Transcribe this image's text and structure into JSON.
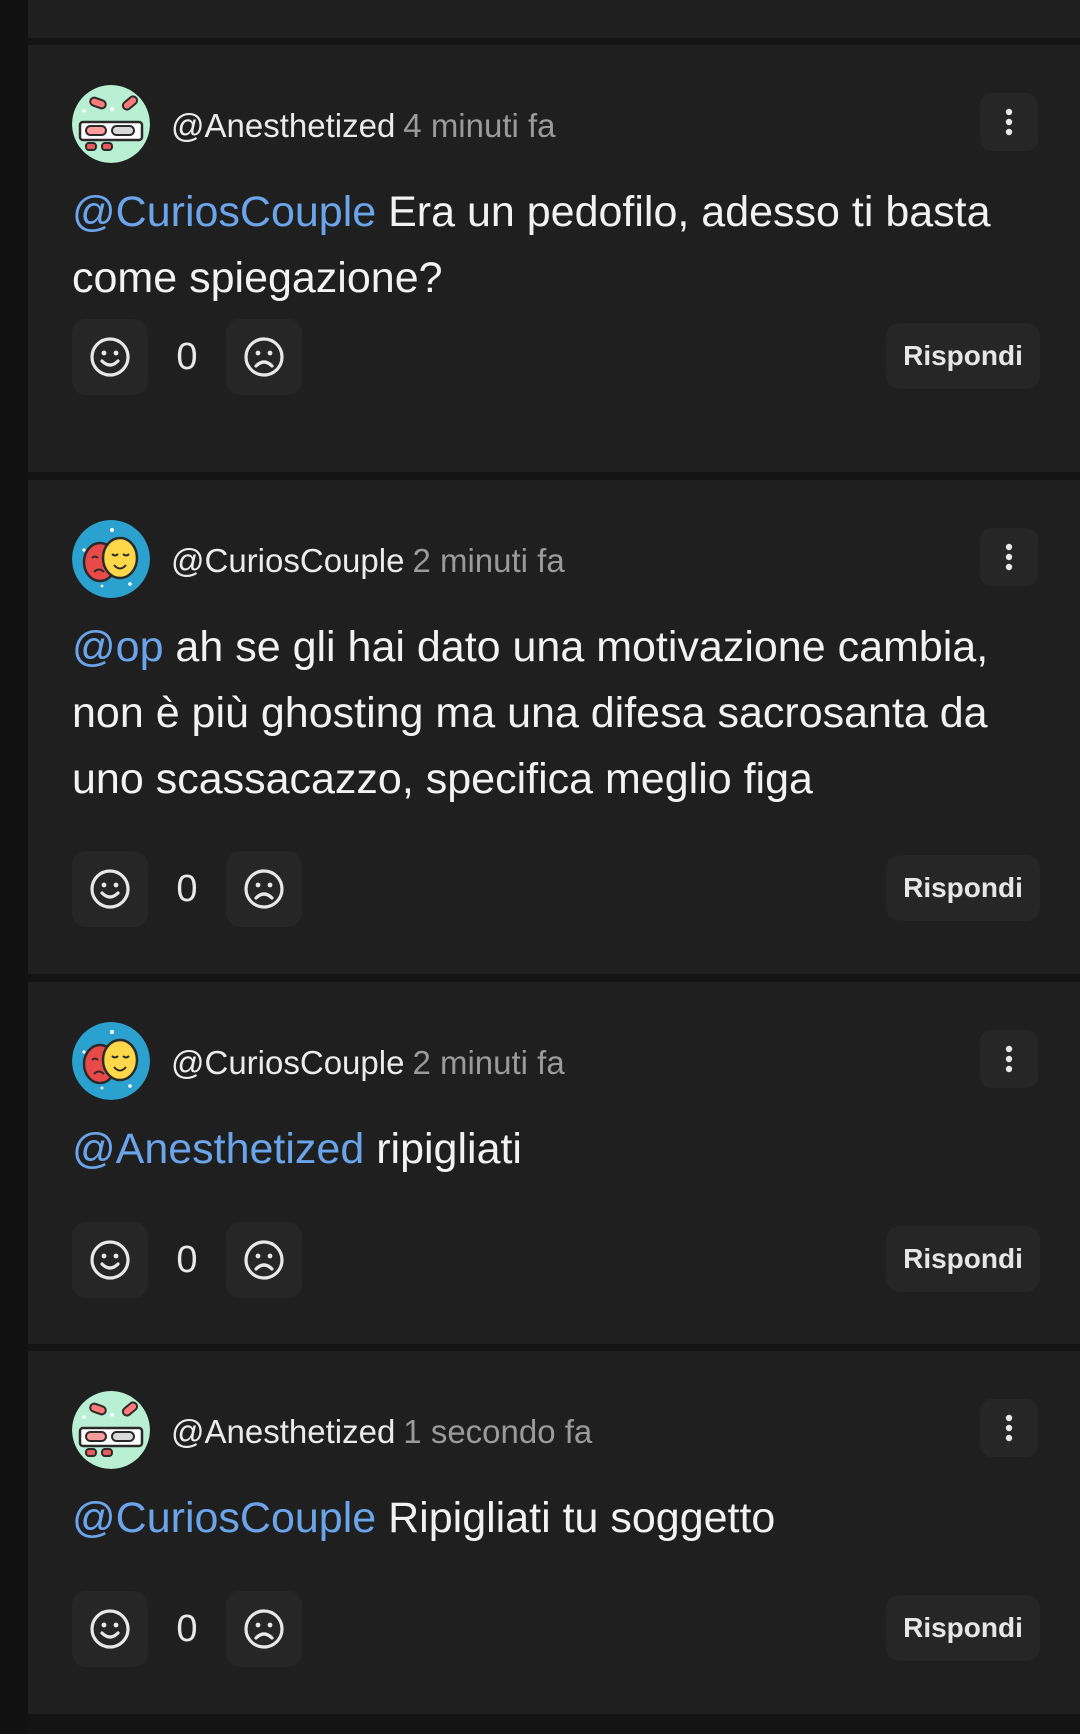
{
  "comments": [
    {
      "username": "@Anesthetized",
      "time": "4 minuti fa",
      "avatar": "pills-avatar",
      "mention": "@CuriosCouple",
      "text": " Era un pedofilo, adesso ti basta come spiegazione?",
      "score": "0",
      "reply_label": "Rispondi"
    },
    {
      "username": "@CuriosCouple",
      "time": "2 minuti fa",
      "avatar": "masks-avatar",
      "mention": "@op",
      "text": " ah se gli hai dato una motivazione cambia, non è più ghosting ma una difesa sacrosanta da uno scassacazzo, specifica meglio figa",
      "score": "0",
      "reply_label": "Rispondi"
    },
    {
      "username": "@CuriosCouple",
      "time": "2 minuti fa",
      "avatar": "masks-avatar",
      "mention": "@Anesthetized",
      "text": " ripigliati",
      "score": "0",
      "reply_label": "Rispondi"
    },
    {
      "username": "@Anesthetized",
      "time": "1 secondo fa",
      "avatar": "pills-avatar",
      "mention": "@CuriosCouple",
      "text": " Ripigliati tu soggetto",
      "score": "0",
      "reply_label": "Rispondi"
    }
  ],
  "colors": {
    "background": "#141414",
    "card": "#1f1f1f",
    "button": "#262626",
    "mention": "#6aa4ea",
    "time": "#9a9a9a"
  },
  "icons": [
    "smile-icon",
    "frown-icon",
    "more-vertical-icon"
  ]
}
